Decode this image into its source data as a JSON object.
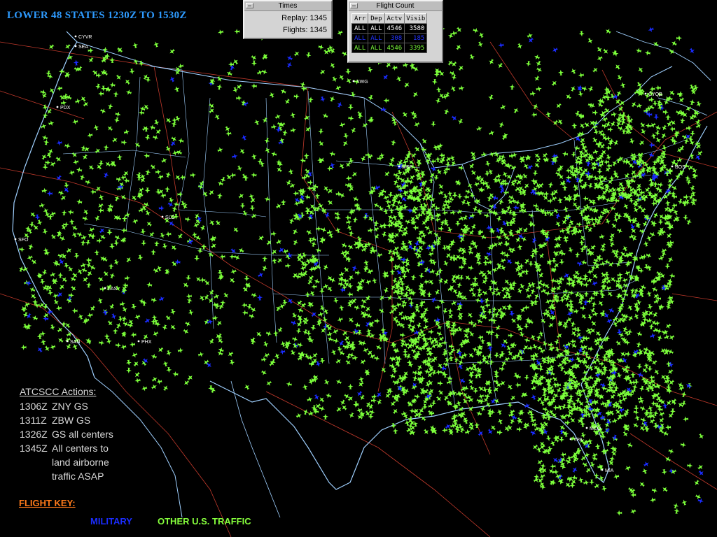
{
  "title": "LOWER 48 STATES 1230Z TO 1530Z",
  "times_window": {
    "title": "Times",
    "replay_label": "Replay:",
    "replay_value": "1345",
    "flights_label": "Flights:",
    "flights_value": "1345"
  },
  "flight_count_window": {
    "title": "Flight Count",
    "columns": [
      "Arr",
      "Dep",
      "Actv",
      "Visib"
    ],
    "rows": [
      {
        "arr": "ALL",
        "dep": "ALL",
        "actv": "4546",
        "visib": "3580"
      },
      {
        "arr": "ALL",
        "dep": "ALL",
        "actv": "308",
        "visib": "185"
      },
      {
        "arr": "ALL",
        "dep": "ALL",
        "actv": "4546",
        "visib": "3395"
      }
    ]
  },
  "actions": {
    "header": "ATCSCC Actions:",
    "items": [
      {
        "time": "1306Z",
        "text": "ZNY GS"
      },
      {
        "time": "1311Z",
        "text": "ZBW GS"
      },
      {
        "time": "1326Z",
        "text": "GS all centers"
      },
      {
        "time": "1345Z",
        "text": "All centers to land airborne traffic ASAP"
      }
    ]
  },
  "flight_key": {
    "label": "FLIGHT KEY:",
    "military": "MILITARY",
    "other": "OTHER U.S. TRAFFIC"
  },
  "airports": [
    {
      "code": "SEA"
    },
    {
      "code": "PDX"
    },
    {
      "code": "SLC"
    },
    {
      "code": "SFO"
    },
    {
      "code": "LAS"
    },
    {
      "code": "SAN"
    },
    {
      "code": "PHX"
    },
    {
      "code": "MSP"
    },
    {
      "code": "CYQB"
    },
    {
      "code": "BOS"
    },
    {
      "code": "MCO"
    },
    {
      "code": "MIA"
    },
    {
      "code": "TPA"
    },
    {
      "code": "YWG"
    },
    {
      "code": "CYVR"
    }
  ],
  "colors": {
    "background": "#000000",
    "other_traffic": "#7cff3b",
    "military": "#1a2cff",
    "coastline": "#9fd0ff",
    "boundary": "#c0392b",
    "title": "#2e9bff",
    "key_label": "#ff7a1a"
  }
}
